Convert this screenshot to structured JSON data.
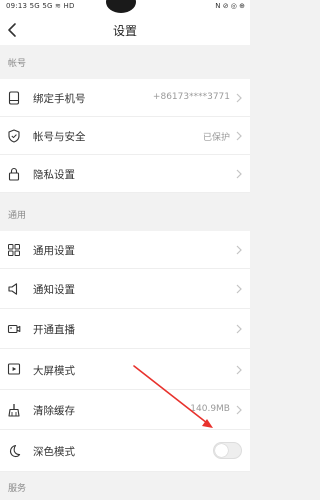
{
  "status_bar": {
    "time": "09:13",
    "left_indicators": "5G 5G ≋ HD",
    "right_indicators": "N ⊘ ◎ ⊕"
  },
  "nav": {
    "title": "设置"
  },
  "sections": {
    "account": {
      "header": "帐号",
      "rows": [
        {
          "label": "绑定手机号",
          "value": "+86173****3771",
          "icon": "phone-icon"
        },
        {
          "label": "帐号与安全",
          "value": "已保护",
          "icon": "shield-icon"
        },
        {
          "label": "隐私设置",
          "icon": "lock-icon"
        }
      ]
    },
    "general": {
      "header": "通用",
      "rows": [
        {
          "label": "通用设置",
          "icon": "grid-icon"
        },
        {
          "label": "通知设置",
          "icon": "speaker-icon"
        },
        {
          "label": "开通直播",
          "icon": "video-camera-icon"
        },
        {
          "label": "大屏模式",
          "icon": "play-screen-icon"
        },
        {
          "label": "清除缓存",
          "value": "140.9MB",
          "icon": "broom-icon"
        },
        {
          "label": "深色模式",
          "icon": "moon-icon",
          "toggle_on": false
        }
      ]
    },
    "service": {
      "header": "服务"
    }
  },
  "colors": {
    "page_bg": "#f2f2f2",
    "row_bg": "#ffffff",
    "annotation_arrow": "#e8322d"
  }
}
